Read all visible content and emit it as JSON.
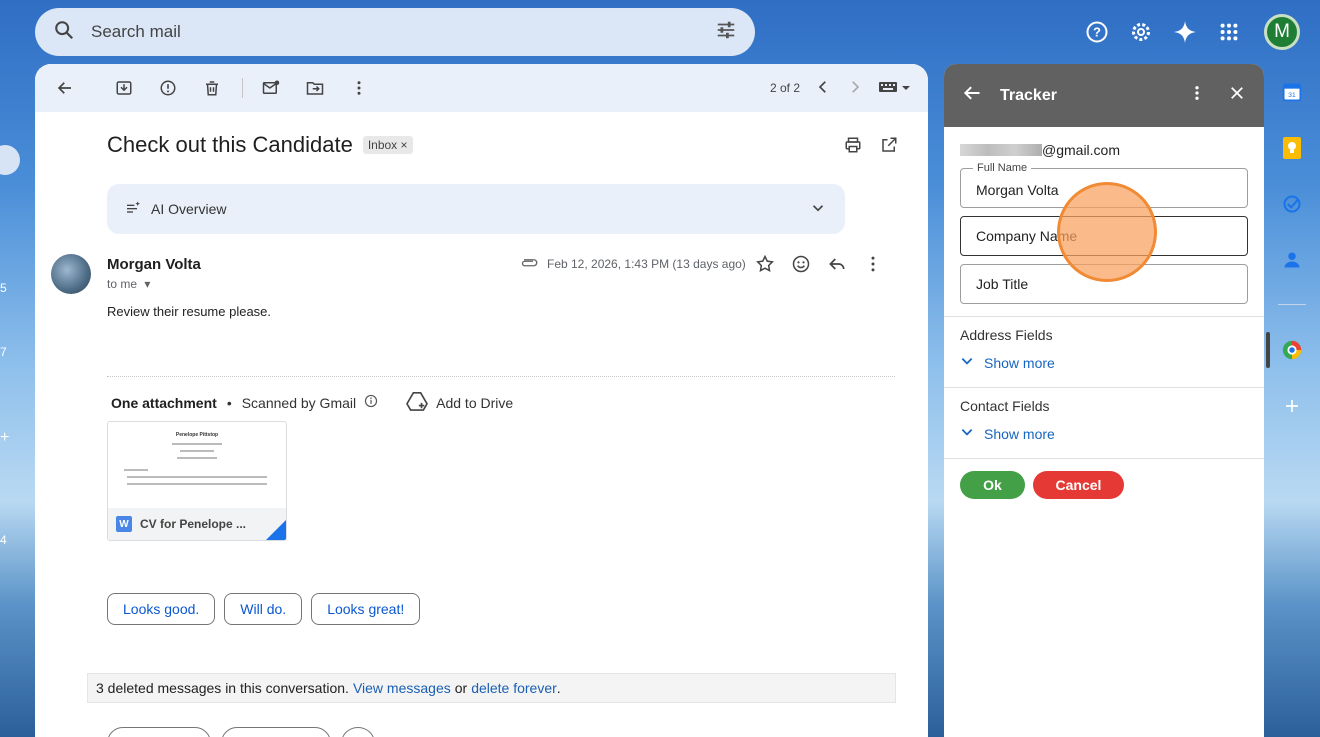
{
  "search": {
    "placeholder": "Search mail"
  },
  "top_icons": [
    "help-icon",
    "settings-icon",
    "gemini-icon",
    "apps-icon"
  ],
  "account": {
    "initial": "M",
    "color": "#1e7e34"
  },
  "left_rail_fragments": [
    "5",
    "7",
    "+",
    "4"
  ],
  "toolbar": {
    "pager": "2 of 2",
    "icons": [
      "back-icon",
      "archive-icon",
      "report-spam-icon",
      "delete-icon",
      "mark-unread-icon",
      "move-to-icon",
      "more-icon"
    ]
  },
  "email": {
    "subject": "Check out this Candidate",
    "label_chip": "Inbox",
    "label_chip_close": "×",
    "ai_overview": "AI Overview",
    "sender": "Morgan Volta",
    "to": "to me",
    "date": "Feb 12, 2026, 1:43 PM (13 days ago)",
    "body": "Review their resume please.",
    "attachments_title": "One attachment",
    "scanned": "Scanned by Gmail",
    "bullet": "•",
    "add_to_drive": "Add to Drive",
    "attachment_name": "CV for Penelope ...",
    "attachment_type_letter": "W",
    "preview_name": "Penelope Pittstop"
  },
  "smart_replies": [
    "Looks good.",
    "Will do.",
    "Looks great!"
  ],
  "deleted": {
    "text": "3 deleted messages in this conversation.",
    "view_link": "View messages",
    "or": "or",
    "delete_link": "delete forever",
    "period": "."
  },
  "tracker": {
    "title": "Tracker",
    "email_suffix": "@gmail.com",
    "full_name_label": "Full Name",
    "full_name_value": "Morgan Volta",
    "company_placeholder": "Company Name",
    "job_title_placeholder": "Job Title",
    "address_section": "Address Fields",
    "contact_section": "Contact Fields",
    "show_more": "Show more",
    "ok": "Ok",
    "cancel": "Cancel",
    "ok_color": "#43a047",
    "cancel_color": "#e53935"
  },
  "app_rail": [
    "calendar-icon",
    "keep-icon",
    "tasks-icon",
    "contacts-icon",
    "tracker-addon-icon",
    "add-icon"
  ]
}
